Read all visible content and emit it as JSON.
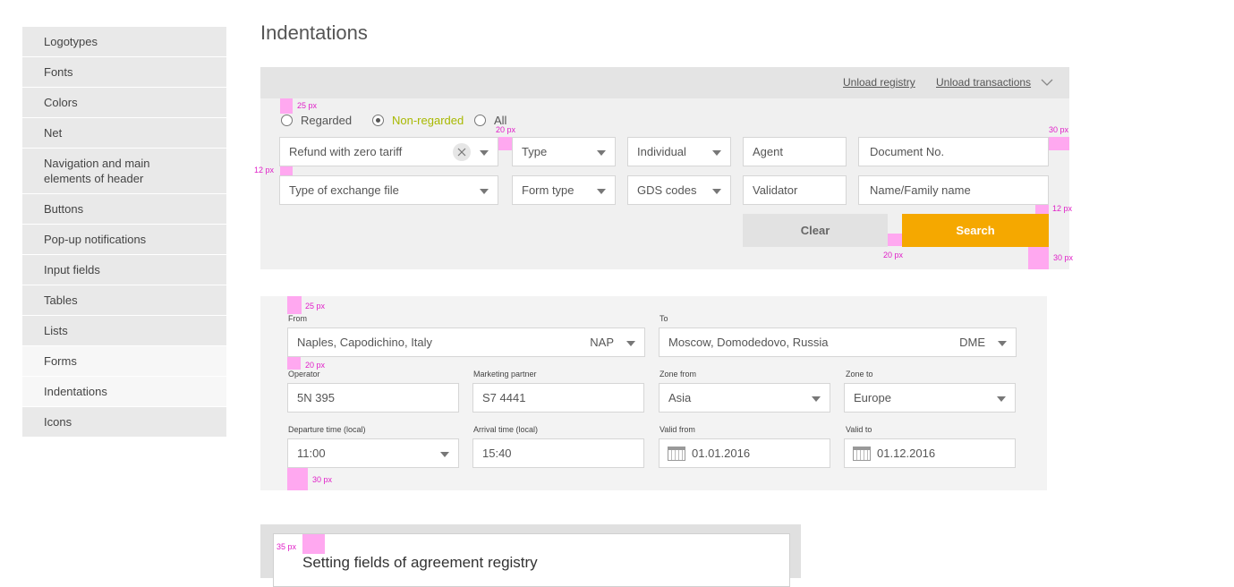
{
  "sidebar": {
    "items": [
      {
        "label": "Logotypes"
      },
      {
        "label": "Fonts"
      },
      {
        "label": "Colors"
      },
      {
        "label": "Net"
      },
      {
        "label": "Navigation and main\nelements of header"
      },
      {
        "label": "Buttons"
      },
      {
        "label": "Pop-up notifications"
      },
      {
        "label": "Input fields"
      },
      {
        "label": "Tables"
      },
      {
        "label": "Lists"
      },
      {
        "label": "Forms"
      },
      {
        "label": "Indentations"
      },
      {
        "label": "Icons"
      }
    ]
  },
  "page": {
    "title": "Indentations"
  },
  "search_panel": {
    "toolbar": {
      "unload_registry": "Unload registry",
      "unload_transactions": "Unload transactions",
      "chevron_icon": "chevron-down-icon"
    },
    "radios": [
      {
        "label": "Regarded",
        "checked": false
      },
      {
        "label": "Non-regarded",
        "checked": true
      },
      {
        "label": "All",
        "checked": false
      }
    ],
    "row1": {
      "refund": "Refund with zero tariff",
      "type": "Type",
      "individual": "Individual",
      "agent": "Agent",
      "document_no": "Document No."
    },
    "row2": {
      "exchange_file": "Type of exchange file",
      "form_type": "Form type",
      "gds_codes": "GDS codes",
      "validator": "Validator",
      "name": "Name/Family name"
    },
    "buttons": {
      "clear": "Clear",
      "search": "Search"
    },
    "accent": "#f5a800",
    "measures": {
      "m25": "25 px",
      "m20a": "20 px",
      "m30a": "30 px",
      "m12a": "12 px",
      "m12b": "12 px",
      "m20b": "20 px",
      "m30b": "30 px"
    }
  },
  "route_panel": {
    "from_label": "From",
    "from_value": "Naples, Capodichino, Italy",
    "from_code": "NAP",
    "to_label": "To",
    "to_value": "Moscow, Domodedovo, Russia",
    "to_code": "DME",
    "operator_label": "Operator",
    "operator_value": "5N 395",
    "partner_label": "Marketing partner",
    "partner_value": "S7 4441",
    "zone_from_label": "Zone from",
    "zone_from_value": "Asia",
    "zone_to_label": "Zone to",
    "zone_to_value": "Europe",
    "departure_label": "Departure time (local)",
    "departure_value": "11:00",
    "arrival_label": "Arrival time (local)",
    "arrival_value": "15:40",
    "valid_from_label": "Valid from",
    "valid_from_value": "01.01.2016",
    "valid_to_label": "Valid to",
    "valid_to_value": "01.12.2016",
    "measures": {
      "m25": "25 px",
      "m20": "20 px",
      "m30": "30 px"
    }
  },
  "registry_panel": {
    "title": "Setting fields of agreement registry",
    "measure": "35 px"
  }
}
